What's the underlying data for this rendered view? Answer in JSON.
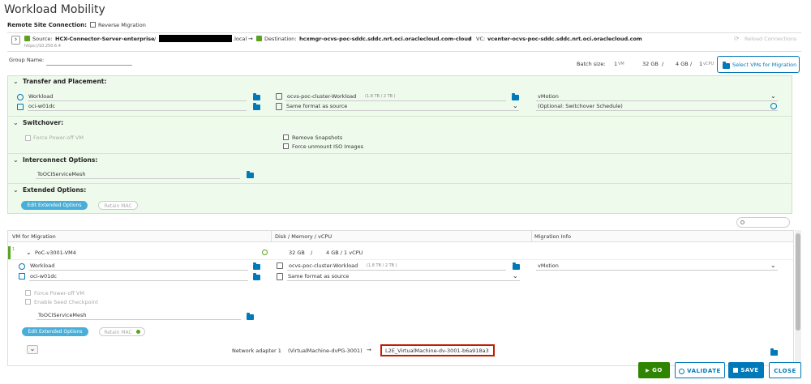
{
  "title": "Workload Mobility",
  "remote": {
    "label": "Remote Site Connection:",
    "reverse": "Reverse Migration",
    "source_label": "Source:",
    "source_name": "HCX-Connector-Server-enterprise",
    "source_sep": "/",
    "source_domain": ".local",
    "source_url": "https://10.250.6.4",
    "dest_label": "Destination:",
    "dest_name": "hcxmgr-ocvs-poc-sddc.sddc.nrt.oci.oraclecloud.com-cloud",
    "dest_sep": "/",
    "vc_label": "VC:",
    "vc_name": "vcenter-ocvs-poc-sddc.sddc.nrt.oci.oraclecloud.com",
    "reload": "Reload Connections"
  },
  "group": {
    "label": "Group Name:"
  },
  "batch": {
    "label": "Batch size:",
    "vms_n": "1",
    "vms_u": "VM",
    "mem_n": "32 GB",
    "mem_sep": "/",
    "disk_n": "4 GB",
    "disk_sep": "/",
    "cpu_n": "1",
    "cpu_u": "vCPU",
    "select_btn": "Select VMs for Migration"
  },
  "transfer": {
    "header": "Transfer and Placement:",
    "folder": "Workload",
    "cluster": "ocvs-poc-cluster-Workload",
    "cluster_size": "(1.8 TB / 2 TB )",
    "migration": "vMotion",
    "network": "oci-w01dc",
    "format": "Same format as source",
    "schedule": "(Optional: Switchover Schedule)"
  },
  "switchover": {
    "header": "Switchover:",
    "force_power": "Force Power-off VM",
    "remove_snapshots": "Remove Snapshots",
    "force_unmount": "Force unmount ISO Images"
  },
  "interconnect": {
    "header": "Interconnect Options:",
    "mesh": "ToOCIServiceMesh"
  },
  "extended": {
    "header": "Extended Options:",
    "edit": "Edit Extended Options",
    "retain": "Retain MAC"
  },
  "table": {
    "col_vm": "VM for Migration",
    "col_disk": "Disk / Memory / vCPU",
    "col_info": "Migration Info"
  },
  "vm": {
    "index": "1",
    "name": "PoC-v3001-VM4",
    "disk": "32 GB",
    "disk_sep": "/",
    "mem_cpu": "4 GB / 1 vCPU",
    "folder": "Workload",
    "cluster": "ocvs-poc-cluster-Workload",
    "cluster_size": "(1.8 TB / 2 TB )",
    "migration": "vMotion",
    "network": "oci-w01dc",
    "format": "Same format as source",
    "force_power": "Force Power-off VM",
    "seed": "Enable Seed Checkpoint",
    "mesh": "ToOCIServiceMesh",
    "edit": "Edit Extended Options",
    "retain": "Retain MAC",
    "adapter": "Network adapter 1",
    "adapter_src": "(VirtualMachine-dvPG-3001)",
    "arrow": "→",
    "adapter_dst": "L2E_VirtualMachine-dv-3001-b6a918a3"
  },
  "footer": {
    "go": "GO",
    "validate": "VALIDATE",
    "save": "SAVE",
    "close": "CLOSE"
  },
  "colors": {
    "accent": "#0079b8",
    "panel": "#eefaeb",
    "go": "#2f8400",
    "save": "#0079b8",
    "highlight": "#c21d00"
  }
}
